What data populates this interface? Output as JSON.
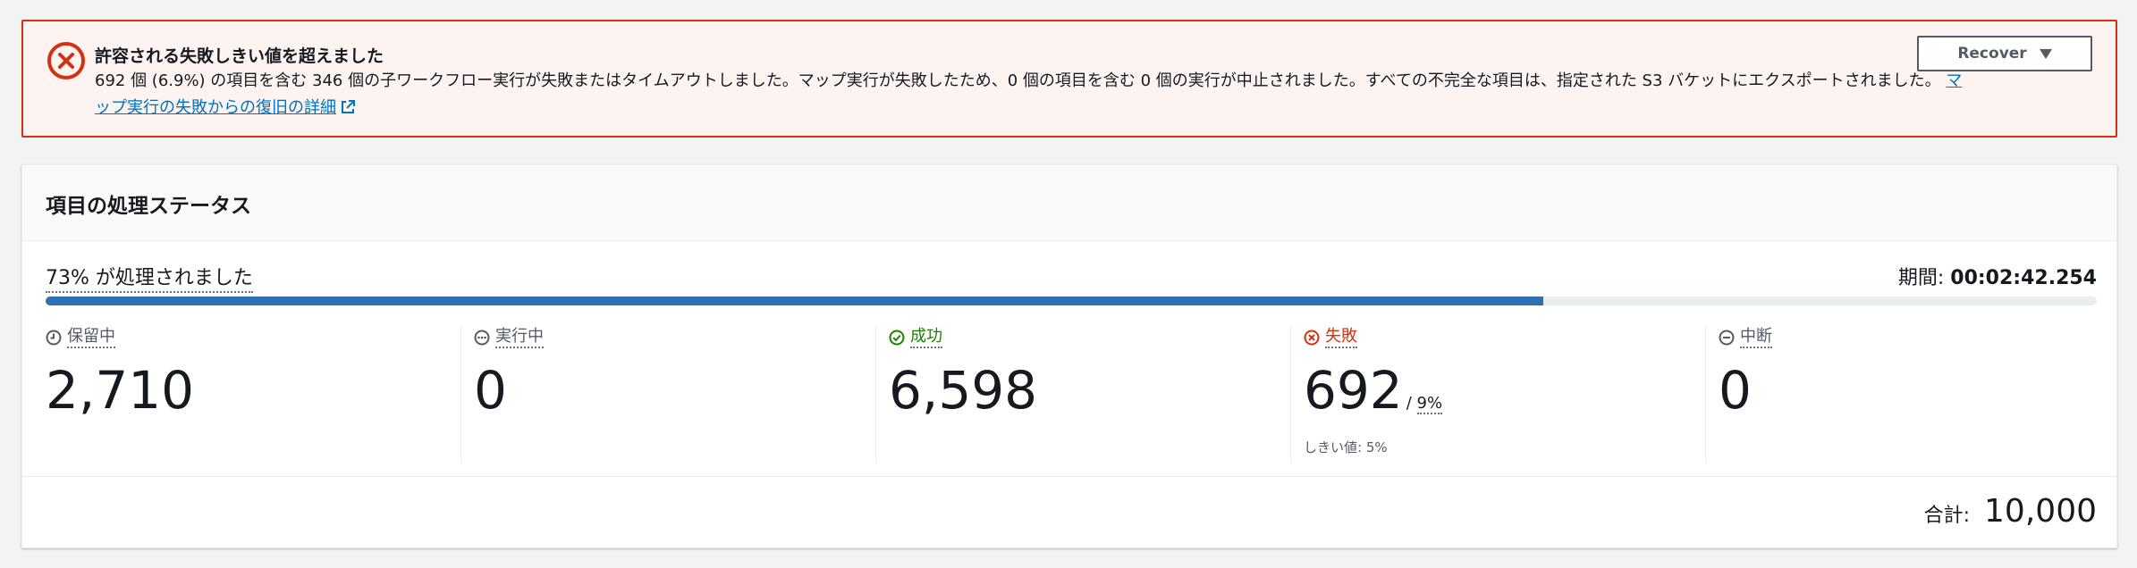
{
  "alert": {
    "title": "許容される失敗しきい値を超えました",
    "message": "692 個 (6.9%) の項目を含む 346 個の子ワークフロー実行が失敗またはタイムアウトしました。マップ実行が失敗したため、0 個の項目を含む 0 個の実行が中止されました。すべての不完全な項目は、指定された S3 バケットにエクスポートされました。",
    "link_label": "マップ実行の失敗からの復旧の詳細",
    "icon": "error-x-circle-icon",
    "color": "#d13212",
    "background": "#fdf3f1",
    "recover_button": "Recover"
  },
  "panel": {
    "title": "項目の処理ステータス",
    "progress_label": "73% が処理されました",
    "progress_percent": 73,
    "progress_color": "#2f6fb3",
    "duration_label": "期間: ",
    "duration_value": "00:02:42.254"
  },
  "stats": [
    {
      "label": "保留中",
      "value": "2,710",
      "icon": "clock-icon",
      "color": "#545b64"
    },
    {
      "label": "実行中",
      "value": "0",
      "icon": "ellipsis-circle-icon",
      "color": "#545b64"
    },
    {
      "label": "成功",
      "value": "6,598",
      "icon": "check-circle-icon",
      "color": "#1d8102"
    },
    {
      "label": "失敗",
      "value": "692",
      "icon": "error-circle-icon",
      "color": "#d13212",
      "percent_sep": "/ ",
      "percent": "9%",
      "threshold": "しきい値: 5%"
    },
    {
      "label": "中断",
      "value": "0",
      "icon": "minus-circle-icon",
      "color": "#545b64"
    }
  ],
  "total": {
    "label": "合計:",
    "value": "10,000"
  }
}
